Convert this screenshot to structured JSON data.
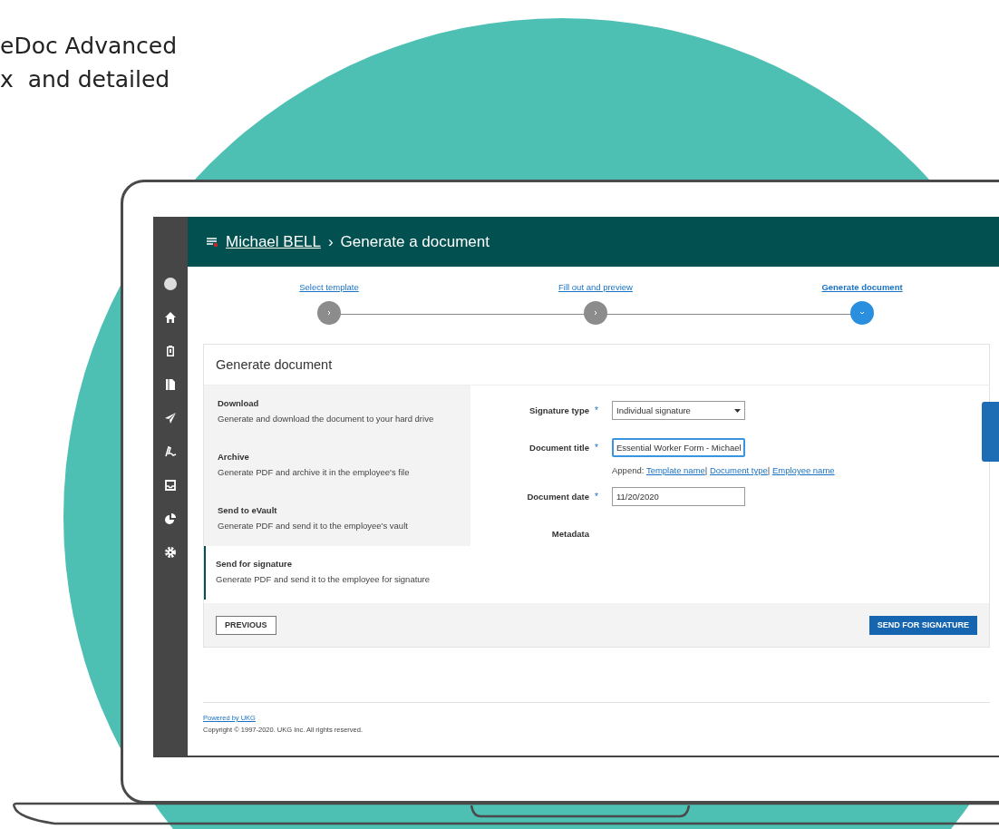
{
  "headline": [
    "eDoc Advanced",
    "x  and detailed"
  ],
  "header": {
    "breadcrumb_link": "Michael BELL",
    "separator": "›",
    "title": "Generate a document"
  },
  "steps": [
    {
      "label": "Select template",
      "selected": false
    },
    {
      "label": "Fill out and preview",
      "selected": false
    },
    {
      "label": "Generate document",
      "selected": true
    }
  ],
  "card": {
    "title": "Generate document",
    "options": [
      {
        "title": "Download",
        "description": "Generate and download the document to your hard drive",
        "selected": false
      },
      {
        "title": "Archive",
        "description": "Generate PDF and archive it in the employee's file",
        "selected": false
      },
      {
        "title": "Send to eVault",
        "description": "Generate PDF and send it to the employee's vault",
        "selected": false
      },
      {
        "title": "Send for signature",
        "description": "Generate PDF and send it to the employee for signature",
        "selected": true
      }
    ],
    "required_mark": "*",
    "fields": [
      {
        "kind": "select",
        "label": "Signature type",
        "required": true,
        "value": "Individual signature"
      },
      {
        "kind": "text",
        "label": "Document title",
        "required": true,
        "value": "Essential Worker Form - Michael",
        "focused": true
      },
      {
        "kind": "append",
        "label": "Append:",
        "separator": "|",
        "links": [
          "Template name",
          "Document type",
          "Employee name"
        ]
      },
      {
        "kind": "text",
        "label": "Document date",
        "required": true,
        "value": "11/20/2020",
        "focused": false
      },
      {
        "kind": "heading",
        "label": "Metadata",
        "required": false
      }
    ],
    "buttons": [
      {
        "label": "PREVIOUS",
        "kind": "secondary"
      },
      {
        "label": "SEND FOR SIGNATURE",
        "kind": "primary"
      }
    ]
  },
  "footer": {
    "link": "Powered by UKG",
    "copyright": "Copyright © 1997-2020. UKG Inc. All rights reserved."
  }
}
